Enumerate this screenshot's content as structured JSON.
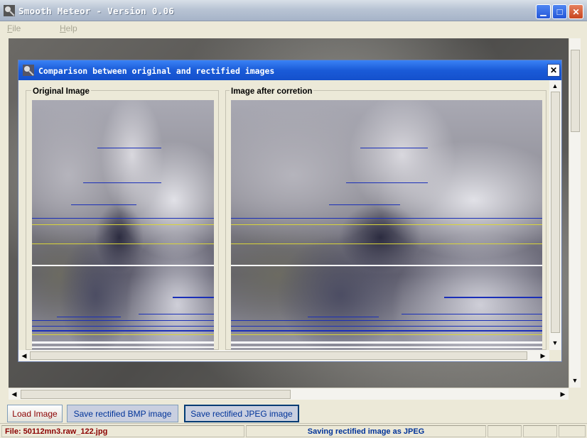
{
  "window": {
    "title": "Smooth Meteor - Version 0.06",
    "icon": "app-icon",
    "minimize_glyph": "▁",
    "maximize_glyph": "□",
    "close_glyph": "✕"
  },
  "menu": {
    "file": {
      "first": "F",
      "rest": "ile"
    },
    "help": {
      "first": "H",
      "rest": "elp"
    }
  },
  "dialog": {
    "title": "Comparison between original and rectified images",
    "close_glyph": "✕",
    "original_label": "Original Image",
    "corrected_label": "Image after corretion"
  },
  "scroll_arrows": {
    "up": "▲",
    "down": "▼",
    "left": "◀",
    "right": "▶"
  },
  "buttons": {
    "load": "Load Image",
    "save_bmp": "Save rectified BMP image",
    "save_jpeg": "Save rectified JPEG image"
  },
  "status": {
    "file": "File: 50112mn3.raw_122.jpg",
    "message": "Saving rectified image as JPEG"
  },
  "colors": {
    "title_gradient": "#1a5bd8",
    "scan_blue": "#1a2fb8",
    "scan_yellow": "#d9d43a",
    "scan_white": "#ffffff",
    "button_red_text": "#8b0000",
    "button_blue_text": "#003399"
  }
}
